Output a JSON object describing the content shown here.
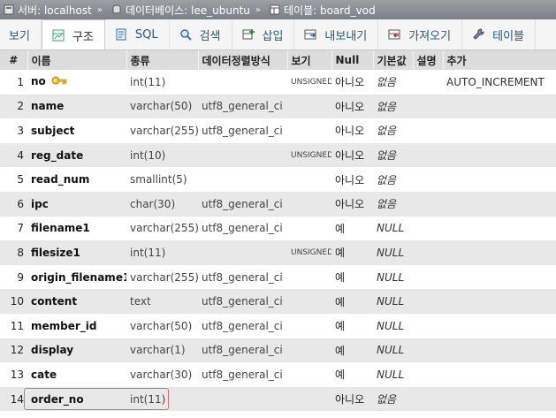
{
  "breadcrumb": {
    "server_label": "서버: localhost",
    "database_label": "데이터베이스: lee_ubuntu",
    "table_label": "테이블: board_vod",
    "separator": "»"
  },
  "tabs": [
    {
      "label": "보기",
      "icon": "browse-icon"
    },
    {
      "label": "구조",
      "icon": "structure-icon"
    },
    {
      "label": "SQL",
      "icon": "sql-icon"
    },
    {
      "label": "검색",
      "icon": "search-icon"
    },
    {
      "label": "삽입",
      "icon": "insert-icon"
    },
    {
      "label": "내보내기",
      "icon": "export-icon"
    },
    {
      "label": "가져오기",
      "icon": "import-icon"
    },
    {
      "label": "테이블",
      "icon": "wrench-icon"
    }
  ],
  "table": {
    "headers": {
      "num": "#",
      "name": "이름",
      "type": "종류",
      "collation": "데이터정렬방식",
      "attributes": "보기",
      "null": "Null",
      "default": "기본값",
      "comment": "설명",
      "extra": "추가"
    },
    "rows": [
      {
        "num": "1",
        "name": "no",
        "type": "int(11)",
        "collation": "",
        "attributes": "UNSIGNED",
        "null": "아니오",
        "default": "없음",
        "extra": "AUTO_INCREMENT"
      },
      {
        "num": "2",
        "name": "name",
        "type": "varchar(50)",
        "collation": "utf8_general_ci",
        "attributes": "",
        "null": "아니오",
        "default": "없음",
        "extra": ""
      },
      {
        "num": "3",
        "name": "subject",
        "type": "varchar(255)",
        "collation": "utf8_general_ci",
        "attributes": "",
        "null": "아니오",
        "default": "없음",
        "extra": ""
      },
      {
        "num": "4",
        "name": "reg_date",
        "type": "int(10)",
        "collation": "",
        "attributes": "UNSIGNED",
        "null": "아니오",
        "default": "없음",
        "extra": ""
      },
      {
        "num": "5",
        "name": "read_num",
        "type": "smallint(5)",
        "collation": "",
        "attributes": "",
        "null": "아니오",
        "default": "없음",
        "extra": ""
      },
      {
        "num": "6",
        "name": "ipc",
        "type": "char(30)",
        "collation": "utf8_general_ci",
        "attributes": "",
        "null": "아니오",
        "default": "없음",
        "extra": ""
      },
      {
        "num": "7",
        "name": "filename1",
        "type": "varchar(255)",
        "collation": "utf8_general_ci",
        "attributes": "",
        "null": "예",
        "default": "NULL",
        "extra": ""
      },
      {
        "num": "8",
        "name": "filesize1",
        "type": "int(11)",
        "collation": "",
        "attributes": "UNSIGNED",
        "null": "예",
        "default": "NULL",
        "extra": ""
      },
      {
        "num": "9",
        "name": "origin_filename1",
        "type": "varchar(255)",
        "collation": "utf8_general_ci",
        "attributes": "",
        "null": "예",
        "default": "NULL",
        "extra": ""
      },
      {
        "num": "10",
        "name": "content",
        "type": "text",
        "collation": "utf8_general_ci",
        "attributes": "",
        "null": "예",
        "default": "NULL",
        "extra": ""
      },
      {
        "num": "11",
        "name": "member_id",
        "type": "varchar(50)",
        "collation": "utf8_general_ci",
        "attributes": "",
        "null": "예",
        "default": "NULL",
        "extra": ""
      },
      {
        "num": "12",
        "name": "display",
        "type": "varchar(1)",
        "collation": "utf8_general_ci",
        "attributes": "",
        "null": "예",
        "default": "NULL",
        "extra": ""
      },
      {
        "num": "13",
        "name": "cate",
        "type": "varchar(30)",
        "collation": "utf8_general_ci",
        "attributes": "",
        "null": "예",
        "default": "NULL",
        "extra": ""
      },
      {
        "num": "14",
        "name": "order_no",
        "type": "int(11)",
        "collation": "",
        "attributes": "",
        "null": "아니오",
        "default": "없음",
        "extra": ""
      }
    ]
  },
  "colors": {
    "highlight_border": "#e46a6a",
    "key_icon": "#e0b020",
    "tab_link": "#235a81"
  }
}
